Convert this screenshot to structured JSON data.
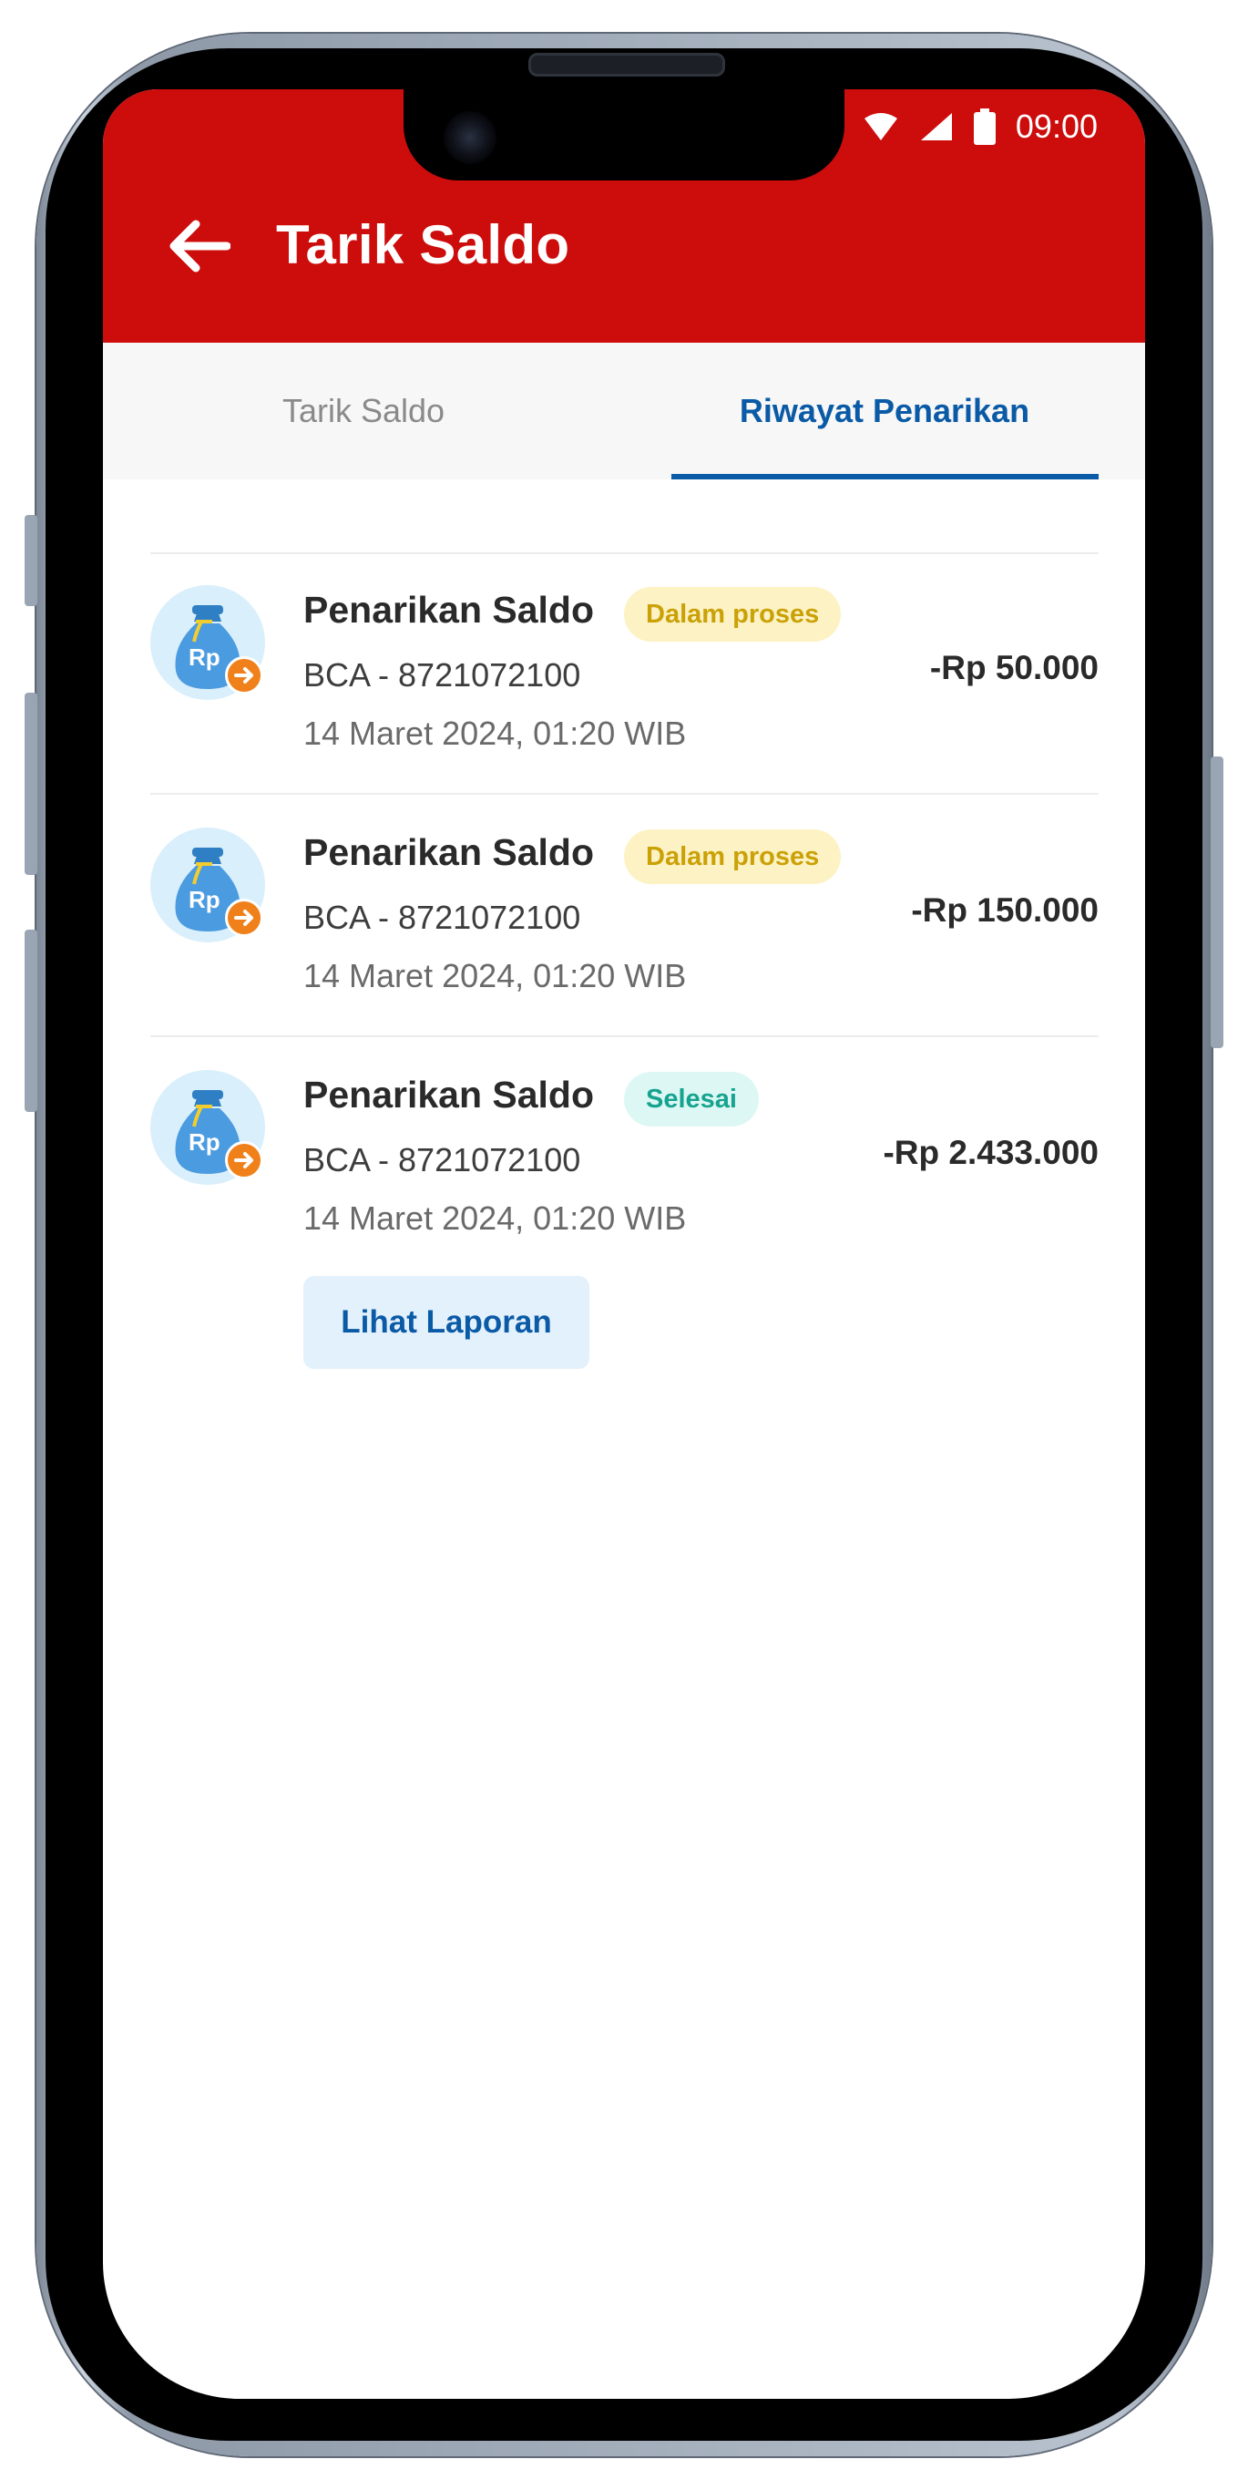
{
  "status_bar": {
    "time": "09:00"
  },
  "header": {
    "title": "Tarik Saldo"
  },
  "tabs": [
    {
      "label": "Tarik Saldo",
      "active": false
    },
    {
      "label": "Riwayat Penarikan",
      "active": true
    }
  ],
  "transactions": [
    {
      "title": "Penarikan Saldo",
      "status": "Dalam proses",
      "bank": "BCA - 8721072100",
      "date": "14 Maret 2024, 01:20 WIB",
      "amount": "-Rp 50.000",
      "icon": "money-bag-icon"
    },
    {
      "title": "Penarikan Saldo",
      "status": "Dalam proses",
      "bank": "BCA - 8721072100",
      "date": "14 Maret 2024, 01:20 WIB",
      "amount": "-Rp 150.000",
      "icon": "money-bag-icon"
    },
    {
      "title": "Penarikan Saldo",
      "status": "Selesai",
      "bank": "BCA - 8721072100",
      "date": "14 Maret 2024, 01:20 WIB",
      "amount": "-Rp 2.433.000",
      "icon": "money-bag-icon",
      "action_label": "Lihat Laporan"
    }
  ],
  "colors": {
    "header_red": "#cd0c0c",
    "active_blue": "#0a5aa6",
    "status_pending_bg": "#fdf2c4",
    "status_pending_text": "#caa106",
    "status_done_bg": "#ddf8f4",
    "status_done_text": "#16a38f",
    "action_orange": "#f0801a"
  }
}
